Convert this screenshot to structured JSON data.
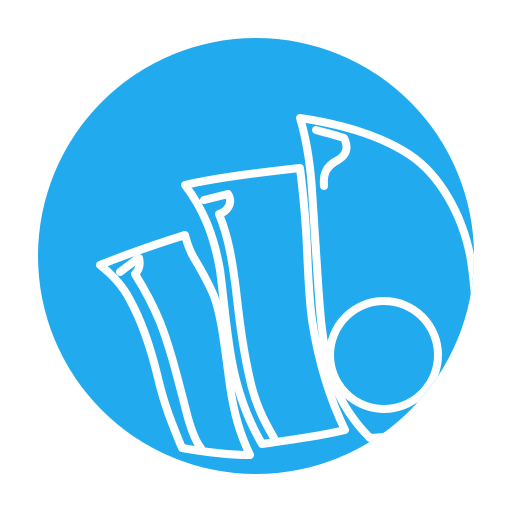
{
  "logo": {
    "icon_name": "money-fan-icon",
    "colors": {
      "background": "#ffffff",
      "circle": "#22AAEE",
      "stroke": "#ffffff"
    }
  }
}
